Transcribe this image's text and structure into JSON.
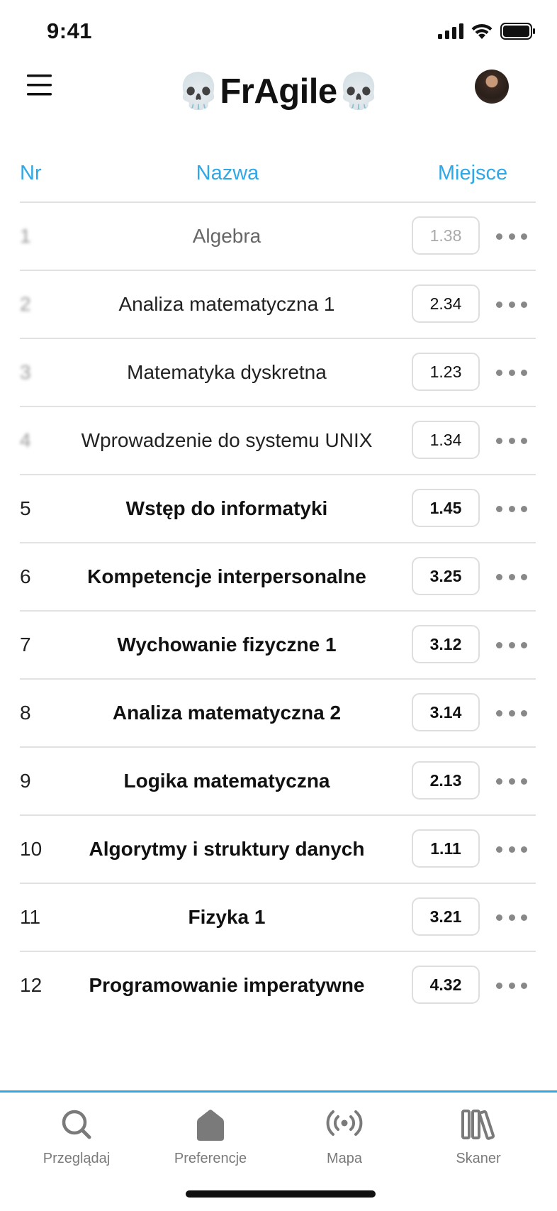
{
  "status_bar": {
    "time": "9:41"
  },
  "header": {
    "title": "💀FrAgile💀"
  },
  "table": {
    "columns": {
      "nr": "Nr",
      "name": "Nazwa",
      "place": "Miejsce"
    },
    "rows": [
      {
        "nr": "1",
        "name": "Algebra",
        "place": "1.38"
      },
      {
        "nr": "2",
        "name": "Analiza matematyczna 1",
        "place": "2.34"
      },
      {
        "nr": "3",
        "name": "Matematyka dyskretna",
        "place": "1.23"
      },
      {
        "nr": "4",
        "name": "Wprowadzenie do systemu UNIX",
        "place": "1.34"
      },
      {
        "nr": "5",
        "name": "Wstęp do informatyki",
        "place": "1.45"
      },
      {
        "nr": "6",
        "name": "Kompetencje interpersonalne",
        "place": "3.25"
      },
      {
        "nr": "7",
        "name": "Wychowanie fizyczne 1",
        "place": "3.12"
      },
      {
        "nr": "8",
        "name": "Analiza matematyczna 2",
        "place": "3.14"
      },
      {
        "nr": "9",
        "name": "Logika matematyczna",
        "place": "2.13"
      },
      {
        "nr": "10",
        "name": "Algorytmy i struktury danych",
        "place": "1.11"
      },
      {
        "nr": "11",
        "name": "Fizyka 1",
        "place": "3.21"
      },
      {
        "nr": "12",
        "name": "Programowanie imperatywne",
        "place": "4.32"
      }
    ]
  },
  "tabbar": {
    "tabs": [
      {
        "label": "Przeglądaj",
        "icon": "search-icon"
      },
      {
        "label": "Preferencje",
        "icon": "home-icon"
      },
      {
        "label": "Mapa",
        "icon": "broadcast-icon"
      },
      {
        "label": "Skaner",
        "icon": "library-icon"
      }
    ]
  },
  "colors": {
    "accent": "#2fa8e6",
    "divider": "#e2e2e2",
    "tab_icon": "#7a7a7a"
  }
}
